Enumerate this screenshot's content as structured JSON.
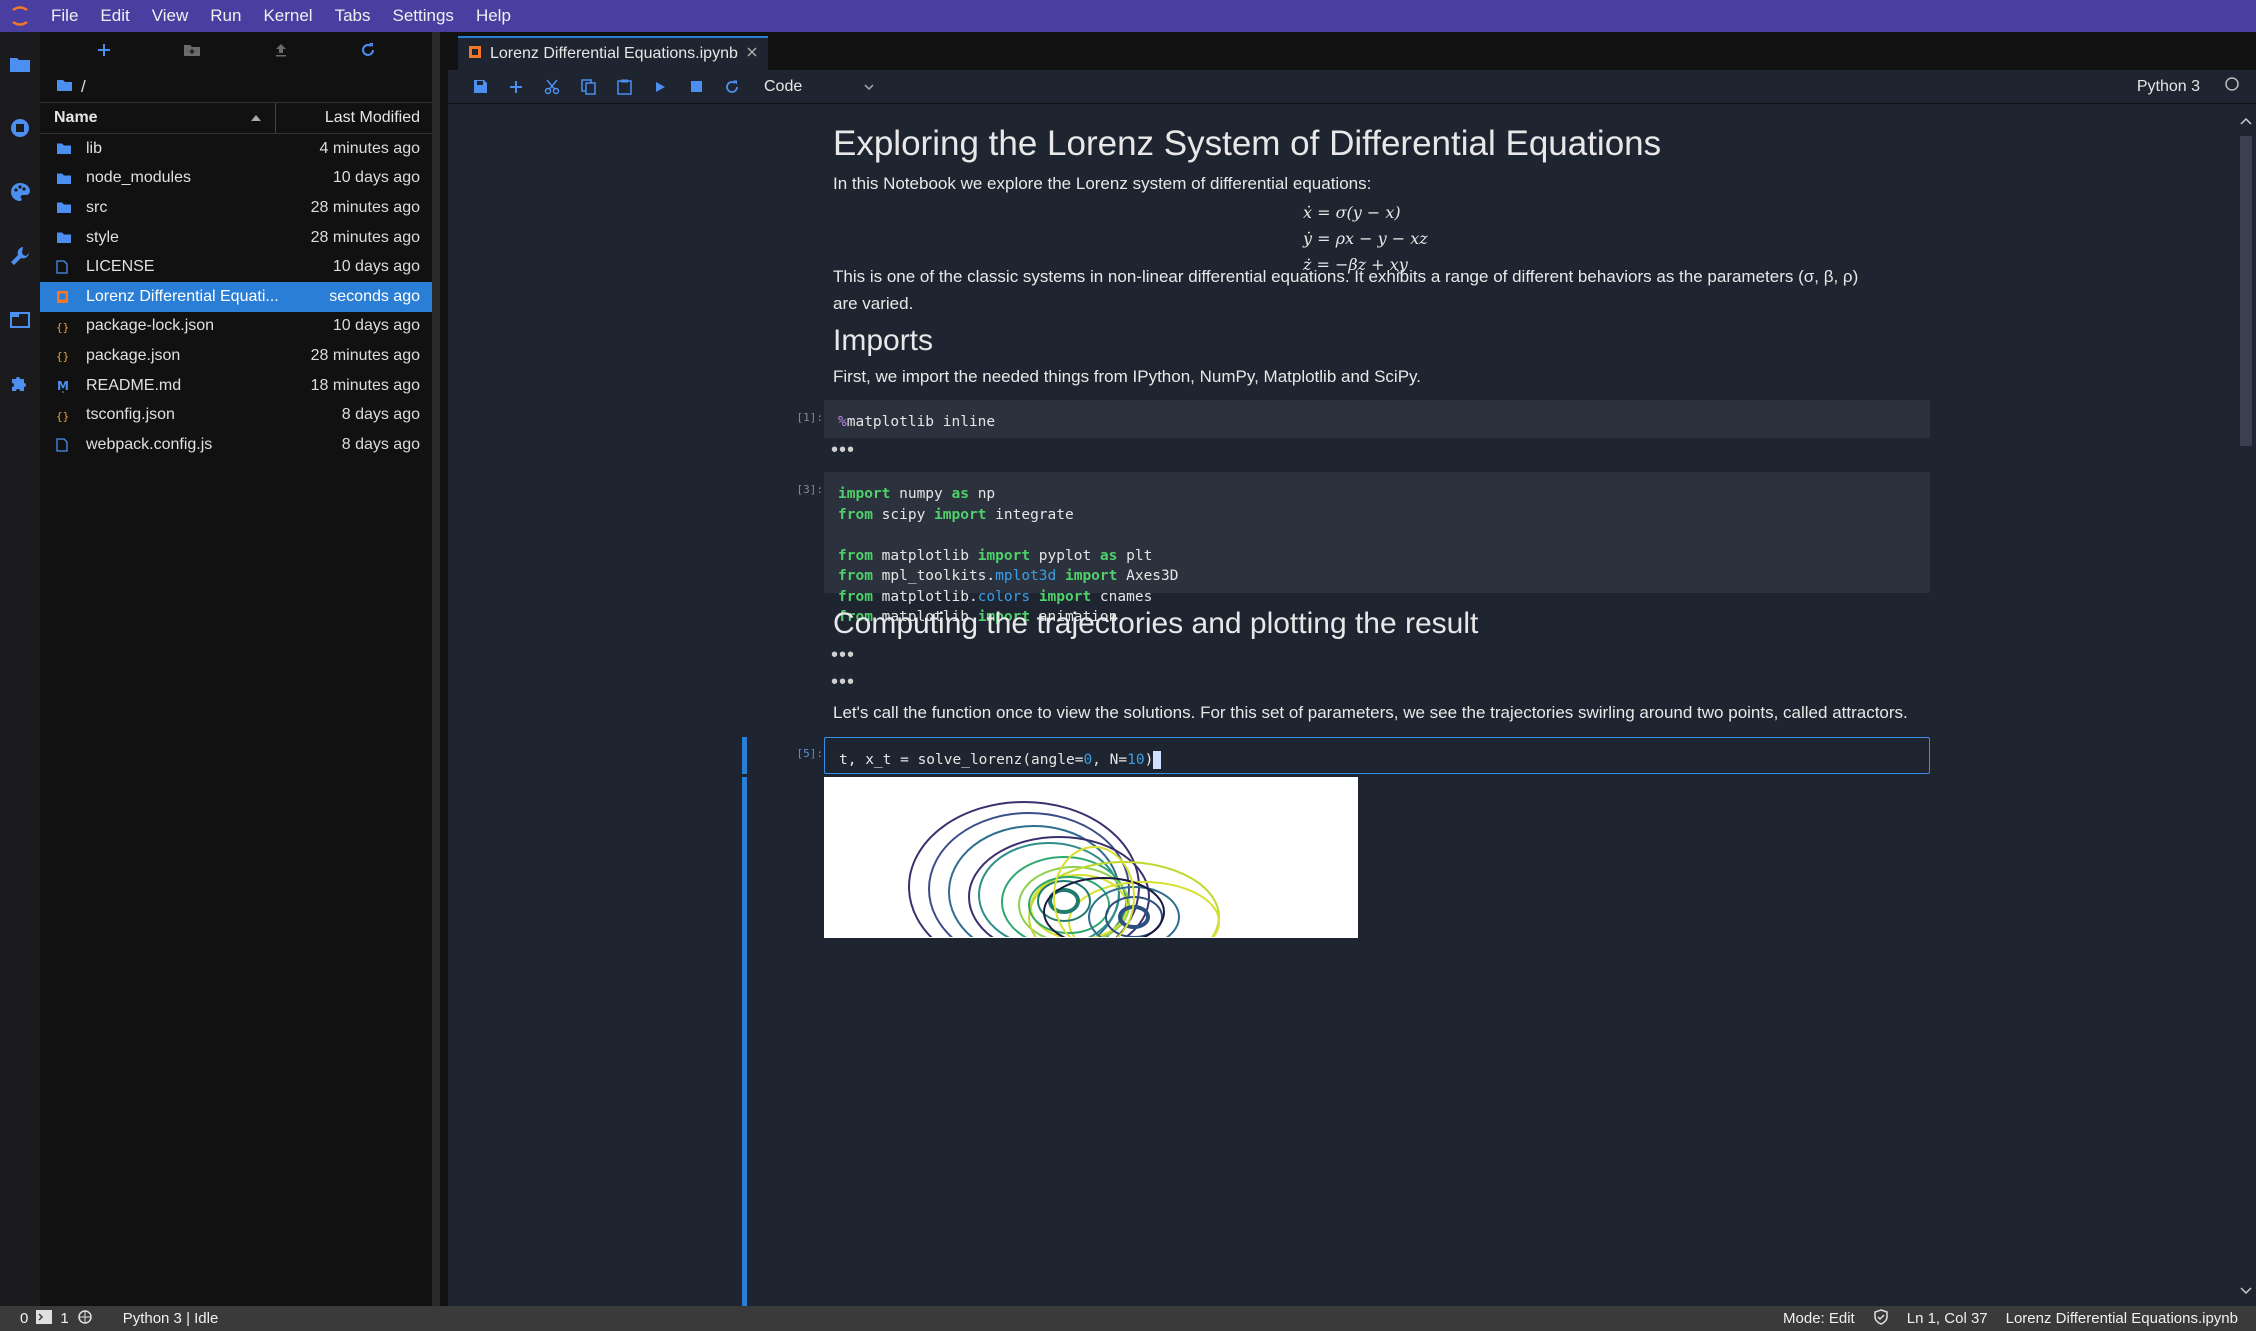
{
  "menubar": {
    "items": [
      "File",
      "Edit",
      "View",
      "Run",
      "Kernel",
      "Tabs",
      "Settings",
      "Help"
    ]
  },
  "activity_bar": {
    "icons": [
      "folder-icon",
      "running-icon",
      "palette-icon",
      "wrench-icon",
      "tabs-icon",
      "extension-icon"
    ]
  },
  "file_browser": {
    "breadcrumb": "/",
    "headers": {
      "name": "Name",
      "modified": "Last Modified"
    },
    "files": [
      {
        "name": "lib",
        "modified": "4 minutes ago",
        "icon": "folder-icon"
      },
      {
        "name": "node_modules",
        "modified": "10 days ago",
        "icon": "folder-icon"
      },
      {
        "name": "src",
        "modified": "28 minutes ago",
        "icon": "folder-icon"
      },
      {
        "name": "style",
        "modified": "28 minutes ago",
        "icon": "folder-icon"
      },
      {
        "name": "LICENSE",
        "modified": "10 days ago",
        "icon": "file-icon"
      },
      {
        "name": "Lorenz Differential Equati...",
        "modified": "seconds ago",
        "icon": "notebook-icon",
        "selected": true
      },
      {
        "name": "package-lock.json",
        "modified": "10 days ago",
        "icon": "json-icon"
      },
      {
        "name": "package.json",
        "modified": "28 minutes ago",
        "icon": "json-icon"
      },
      {
        "name": "README.md",
        "modified": "18 minutes ago",
        "icon": "markdown-icon"
      },
      {
        "name": "tsconfig.json",
        "modified": "8 days ago",
        "icon": "json-icon"
      },
      {
        "name": "webpack.config.js",
        "modified": "8 days ago",
        "icon": "file-icon"
      }
    ]
  },
  "notebook": {
    "tab_title": "Lorenz Differential Equations.ipynb",
    "cell_type": "Code",
    "kernel": "Python 3",
    "title": "Exploring the Lorenz System of Differential Equations",
    "intro": "In this Notebook we explore the Lorenz system of differential equations:",
    "equations": [
      "ẋ = σ(y − x)",
      "ẏ = ρx − y − xz",
      "ż = −βz + xy"
    ],
    "description": "This is one of the classic systems in non-linear differential equations. It exhibits a range of different behaviors as the parameters (σ, β, ρ) are varied.",
    "imports_heading": "Imports",
    "imports_text": "First, we import the needed things from IPython, NumPy, Matplotlib and SciPy.",
    "cell1_prompt": "[1]:",
    "cell3_prompt": "[3]:",
    "computing_heading": "Computing the trajectories and plotting the result",
    "call_text": "Let's call the function once to view the solutions. For this set of parameters, we see the trajectories swirling around two points, called attractors.",
    "cell5_prompt": "[5]:",
    "collapsed_marker": "•••"
  },
  "statusbar": {
    "terminals": "0",
    "kernels": "1",
    "kernel_status": "Python 3 | Idle",
    "mode": "Mode: Edit",
    "position": "Ln 1, Col 37",
    "filename": "Lorenz Differential Equations.ipynb"
  }
}
